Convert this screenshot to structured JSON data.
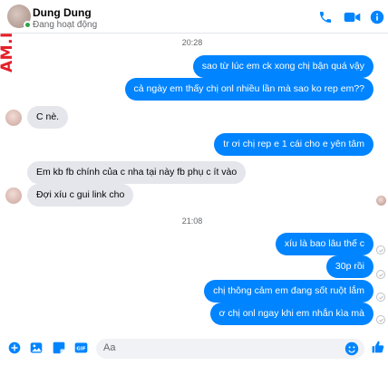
{
  "watermark": "AM.INFO",
  "header": {
    "name": "Dung Dung",
    "status": "Đang hoạt động"
  },
  "timestamps": [
    "20:28",
    "21:08"
  ],
  "messages": [
    {
      "dir": "out",
      "text": "sao từ lúc em ck xong chị bận quá vậy"
    },
    {
      "dir": "out",
      "text": "cả ngày em thấy chị onl nhiều lần mà sao ko rep em??"
    },
    {
      "dir": "in",
      "text": "C nè."
    },
    {
      "dir": "out",
      "text": "tr ơi chị rep e 1 cái cho e yên tâm"
    },
    {
      "dir": "in",
      "text": "Em kb fb chính của c nha tại này fb phụ c ít vào"
    },
    {
      "dir": "in",
      "text": "Đợi xíu c gui link cho"
    },
    {
      "dir": "out",
      "text": "xíu là bao lâu thế c"
    },
    {
      "dir": "out",
      "text": "30p rồi"
    },
    {
      "dir": "out",
      "text": "chị thông cảm em đang sốt ruột lắm"
    },
    {
      "dir": "out",
      "text": "ơ chị onl ngay khi em nhắn kìa mà"
    }
  ],
  "composer": {
    "placeholder": "Aa"
  },
  "colors": {
    "accent": "#0084ff",
    "incoming": "#e4e6eb",
    "online": "#31a24c"
  }
}
